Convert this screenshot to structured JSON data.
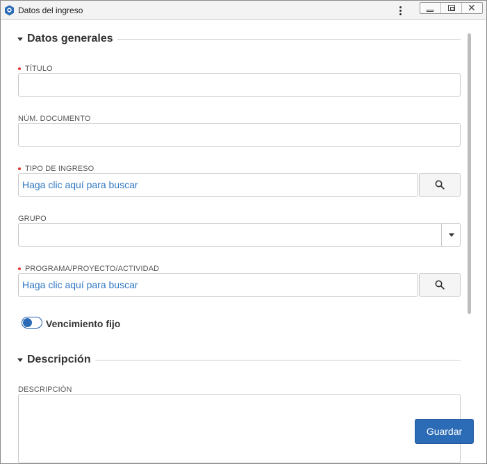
{
  "window": {
    "title": "Datos del ingreso",
    "close_glyph": "✕"
  },
  "sections": {
    "general": {
      "title": "Datos generales"
    },
    "description": {
      "title": "Descripción"
    }
  },
  "fields": {
    "titulo": {
      "label": "TÍTULO",
      "required": true,
      "value": ""
    },
    "num_documento": {
      "label": "NÚM. DOCUMENTO",
      "required": false,
      "value": ""
    },
    "tipo_ingreso": {
      "label": "TIPO DE INGRESO",
      "required": true,
      "placeholder": "Haga clic aquí para buscar"
    },
    "grupo": {
      "label": "GRUPO",
      "required": false,
      "value": ""
    },
    "programa": {
      "label": "PROGRAMA/PROYECTO/ACTIVIDAD",
      "required": true,
      "placeholder": "Haga clic aquí para buscar"
    },
    "vencimiento": {
      "label": "Vencimiento fijo",
      "enabled": true
    },
    "descripcion": {
      "label": "DESCRIPCIÓN",
      "value": ""
    }
  },
  "actions": {
    "save_label": "Guardar"
  },
  "colors": {
    "accent": "#2c6cb7",
    "link": "#2f76c2",
    "required": "#e53935"
  }
}
